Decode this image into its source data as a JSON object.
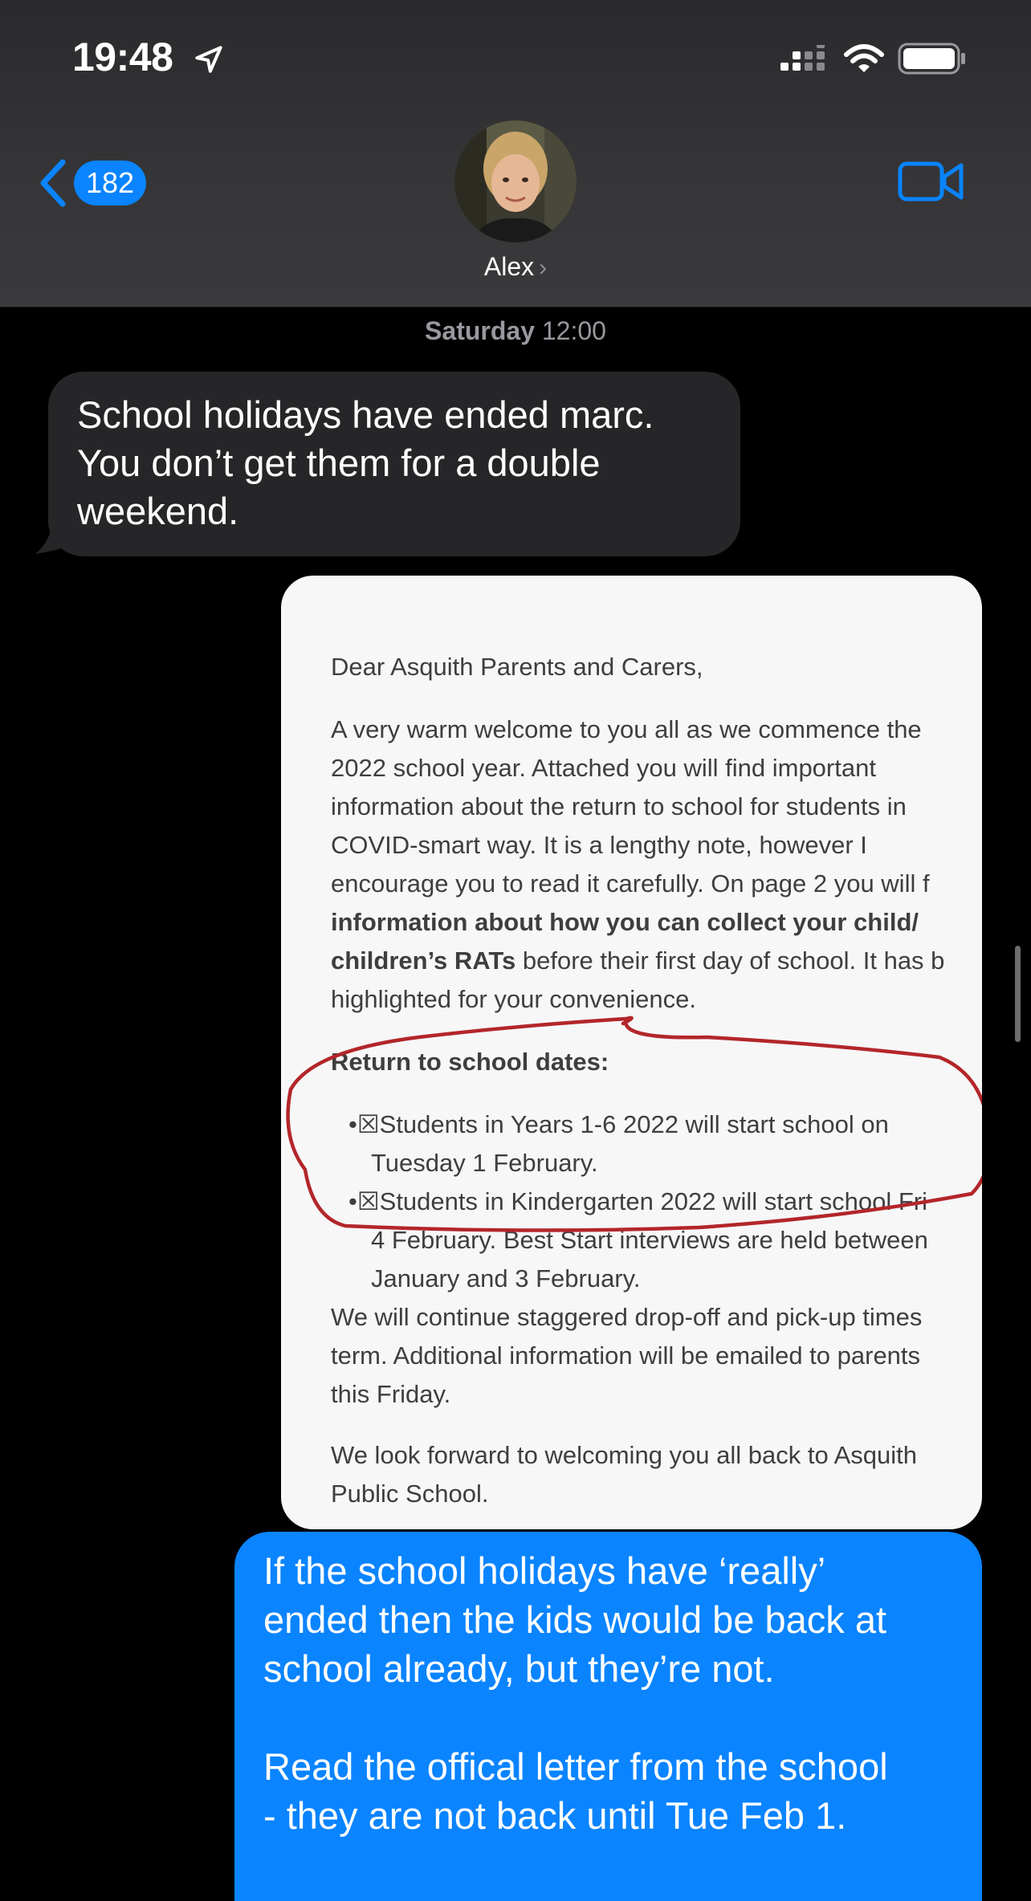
{
  "status_bar": {
    "time": "19:48",
    "icons": [
      "location-arrow-icon",
      "signal-icon",
      "wifi-icon",
      "battery-icon"
    ]
  },
  "header": {
    "back_count": "182",
    "contact_name": "Alex",
    "icons": [
      "chevron-left-icon",
      "video-camera-icon",
      "chevron-right-icon"
    ]
  },
  "conversation": {
    "timestamp_day": "Saturday",
    "timestamp_time": "12:00",
    "incoming_message": {
      "lines": [
        "School holidays have ended marc.",
        "You don’t get them for a double",
        "weekend."
      ]
    },
    "attachment_letter": {
      "greeting": "Dear Asquith Parents and Carers,",
      "para1": [
        "A very warm welcome to you all as we commence the",
        "2022 school year. Attached you will find important",
        "information about the return to school for students in",
        "COVID-smart way. It is a lengthy note, however I",
        "encourage you to read it carefully. On page 2 you will f"
      ],
      "para1_bold_1": "information about how you can collect your child/",
      "para1_bold_2": "children’s RATs",
      "para1_tail": " before their first day of school. It has b",
      "para1_last": "highlighted for your convenience.",
      "dates_heading": "Return to school dates:",
      "bullet1_line1": "•☒Students in Years 1-6 2022 will start school on",
      "bullet1_line2": "Tuesday 1 February.",
      "bullet2_line1": "•☒Students in Kindergarten 2022 will start school Fri",
      "bullet2_line2": "4 February. Best Start interviews are held between",
      "bullet2_line3": "January and 3 February.",
      "para2": [
        "We will continue staggered drop-off and pick-up times",
        "term. Additional information will be emailed to parents",
        "this Friday."
      ],
      "para3": [
        "We look forward to welcoming you all back to Asquith",
        "Public School."
      ],
      "annotation_color": "#b3262a"
    },
    "outgoing_message": {
      "para1": [
        "If the school holidays have ‘really’",
        "ended then the kids would be back at",
        "school already, but they’re not."
      ],
      "para2": [
        "Read the offical letter from the school",
        "- they are not back until Tue Feb 1."
      ]
    }
  },
  "colors": {
    "accent": "#0a84ff",
    "incoming_bubble": "#262628",
    "outgoing_bubble": "#0a84ff",
    "background": "#000000",
    "header": "#353537"
  }
}
